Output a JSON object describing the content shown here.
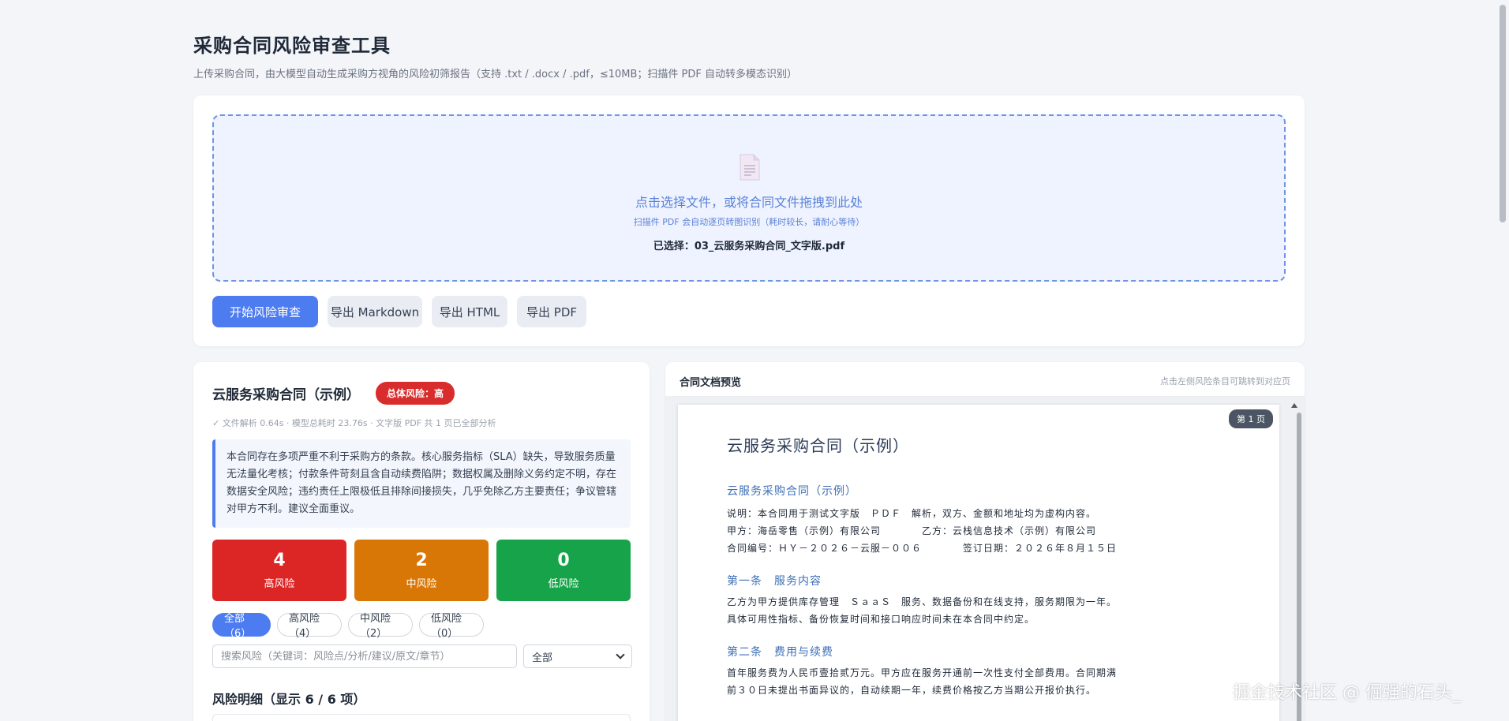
{
  "header": {
    "title": "采购合同风险审查工具",
    "subtitle": "上传采购合同，由大模型自动生成采购方视角的风险初筛报告（支持 .txt / .docx / .pdf，≤10MB；扫描件 PDF 自动转多模态识别）"
  },
  "upload": {
    "icon": "document-icon",
    "main_text": "点击选择文件，或将合同文件拖拽到此处",
    "hint_text": "扫描件 PDF 会自动逐页转图识别（耗时较长，请耐心等待）",
    "selected_text": "已选择：03_云服务采购合同_文字版.pdf"
  },
  "actions": {
    "start": "开始风险审查",
    "export_md": "导出 Markdown",
    "export_html": "导出 HTML",
    "export_pdf": "导出 PDF"
  },
  "result": {
    "title": "云服务采购合同（示例）",
    "overall_risk": "总体风险：高",
    "meta": "✓ 文件解析 0.64s · 模型总耗时 23.76s · 文字版 PDF 共 1 页已全部分析",
    "summary": "本合同存在多项严重不利于采购方的条款。核心服务指标（SLA）缺失，导致服务质量无法量化考核；付款条件苛刻且含自动续费陷阱；数据权属及删除义务约定不明，存在数据安全风险；违约责任上限极低且排除间接损失，几乎免除乙方主要责任；争议管辖对甲方不利。建议全面重议。",
    "stats": {
      "high_count": "4",
      "high_label": "高风险",
      "mid_count": "2",
      "mid_label": "中风险",
      "low_count": "0",
      "low_label": "低风险"
    },
    "filters": [
      "全部（6）",
      "高风险（4）",
      "中风险（2）",
      "低风险（0）"
    ],
    "search_placeholder": "搜索风险（关键词：风险点/分析/建议/原文/章节）",
    "level_select": "全部",
    "detail_title": "风险明细（显示 6 / 6 项）"
  },
  "preview": {
    "title": "合同文档预览",
    "hint": "点击左侧风险条目可跳转到对应页",
    "page_badge": "第 1 页",
    "doc_title": "云服务采购合同（示例）",
    "doc_subtitle": "云服务采购合同（示例）",
    "line1": "说明：本合同用于测试文字版　ＰＤＦ　解析，双方、金额和地址均为虚构内容。",
    "line2": "甲方：海岳零售（示例）有限公司　　　　乙方：云栈信息技术（示例）有限公司",
    "line3": "合同编号：ＨＹ－２０２６－云服－００６　　　　签订日期：２０２６年８月１５日",
    "section1": "第一条　服务内容",
    "s1p1": "乙方为甲方提供库存管理　ＳａａＳ　服务、数据备份和在线支持，服务期限为一年。",
    "s1p2": "具体可用性指标、备份恢复时间和接口响应时间未在本合同中约定。",
    "section2": "第二条　费用与续费",
    "s2p1": "首年服务费为人民币壹拾贰万元。甲方应在服务开通前一次性支付全部费用。合同期满",
    "s2p2": "前３０日未提出书面异议的，自动续期一年，续费价格按乙方当期公开报价执行。"
  },
  "watermark": "掘金技术社区 @ 倔强的石头_",
  "colors": {
    "primary": "#4d7cf1",
    "high": "#dc2626",
    "mid": "#d97706",
    "low": "#16a34a"
  }
}
